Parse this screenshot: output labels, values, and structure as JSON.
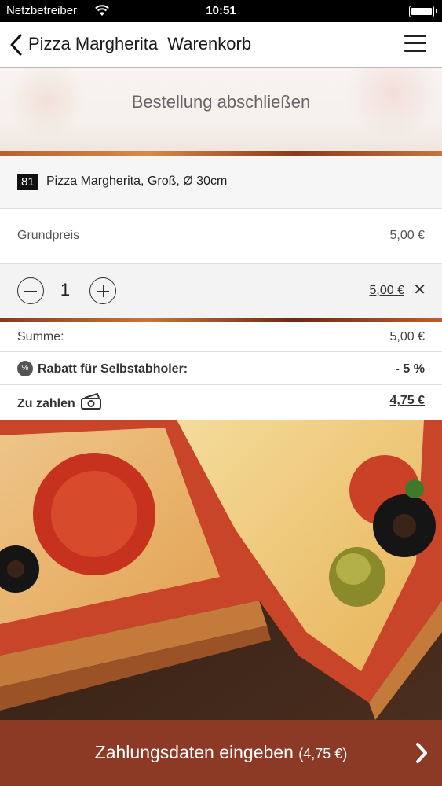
{
  "status_bar": {
    "carrier": "Netzbetreiber",
    "time": "10:51"
  },
  "nav": {
    "title": "Pizza Margherita  Warenkorb"
  },
  "banner": {
    "heading": "Bestellung abschließen"
  },
  "cart_item": {
    "number": "81",
    "name": "Pizza Margherita, Groß, Ø 30cm",
    "base_price_label": "Grundpreis",
    "base_price_value": "5,00 €",
    "quantity": "1",
    "line_total": "5,00 €"
  },
  "summary": {
    "sum_label": "Summe:",
    "sum_value": "5,00 €",
    "discount_badge": "%",
    "discount_label": "Rabatt für Selbstabholer:",
    "discount_value": "- 5 %",
    "total_label": "Zu zahlen",
    "total_value": "4,75 €"
  },
  "checkout": {
    "label": "Zahlungsdaten eingeben",
    "amount": "(4,75 €)"
  },
  "colors": {
    "checkout_bar": "#8c3a25",
    "status_bar": "#000000"
  }
}
